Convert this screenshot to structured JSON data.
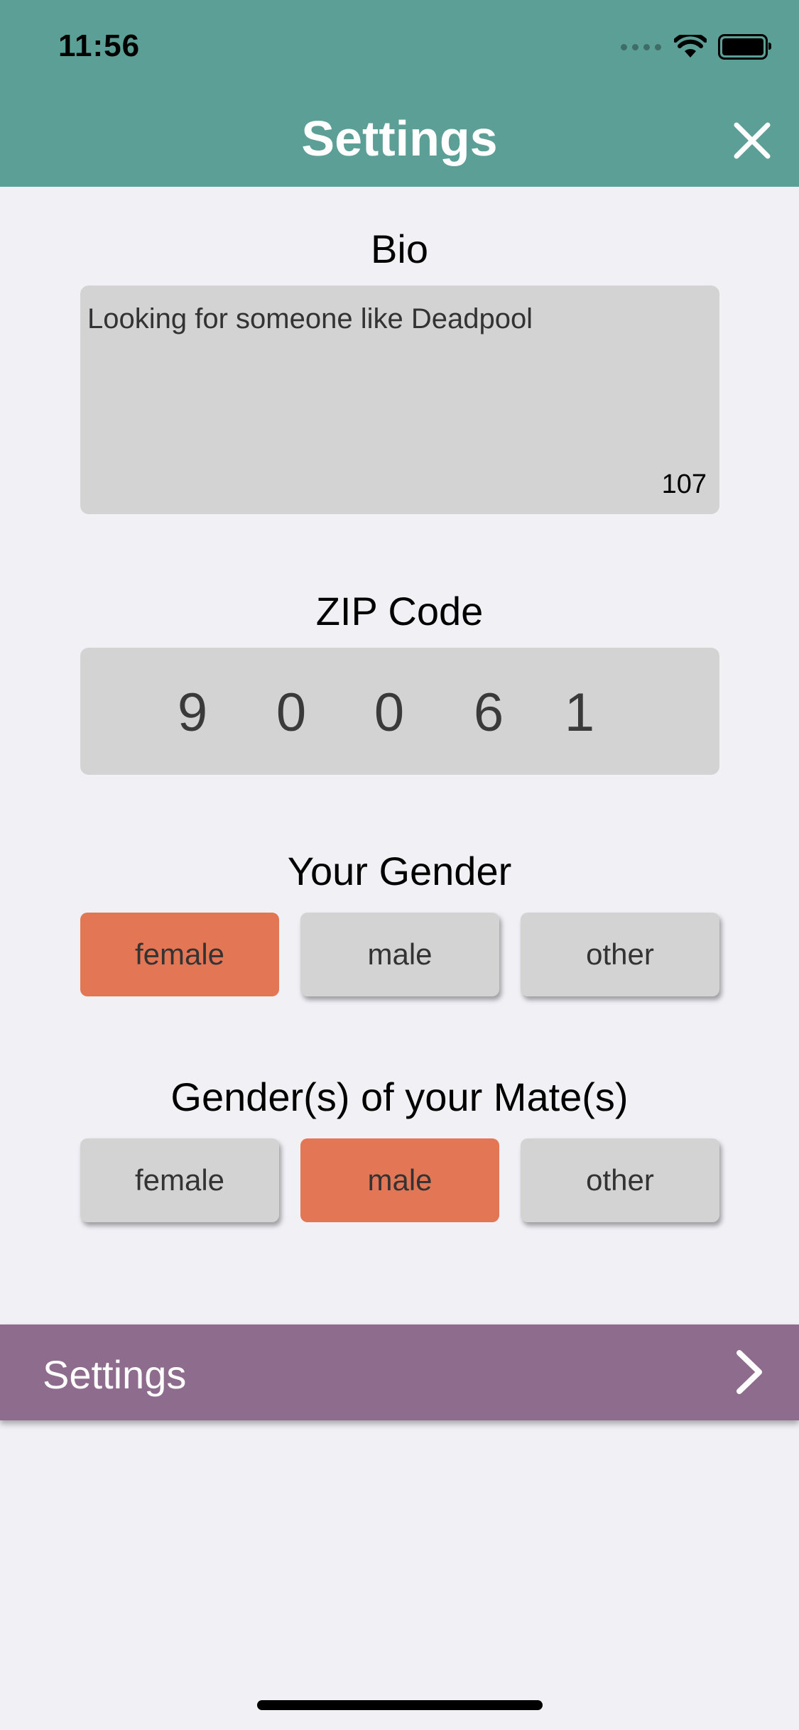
{
  "status_bar": {
    "time": "11:56"
  },
  "header": {
    "title": "Settings"
  },
  "bio": {
    "label": "Bio",
    "value": "Looking for someone like Deadpool",
    "char_count": "107"
  },
  "zip": {
    "label": "ZIP Code",
    "digits": [
      "9",
      "0",
      "0",
      "6",
      "1"
    ]
  },
  "your_gender": {
    "label": "Your Gender",
    "options": [
      "female",
      "male",
      "other"
    ],
    "selected": "female"
  },
  "mate_gender": {
    "label": "Gender(s) of your Mate(s)",
    "options": [
      "female",
      "male",
      "other"
    ],
    "selected": "male"
  },
  "settings_row": {
    "label": "Settings"
  },
  "colors": {
    "header": "#5c9f97",
    "selected": "#e37755",
    "unselected": "#d3d3d3",
    "settings_bar": "#8e6c8e",
    "background": "#f0f0f5"
  },
  "icons": [
    "wifi-icon",
    "battery-icon",
    "close-icon",
    "chevron-right-icon"
  ]
}
